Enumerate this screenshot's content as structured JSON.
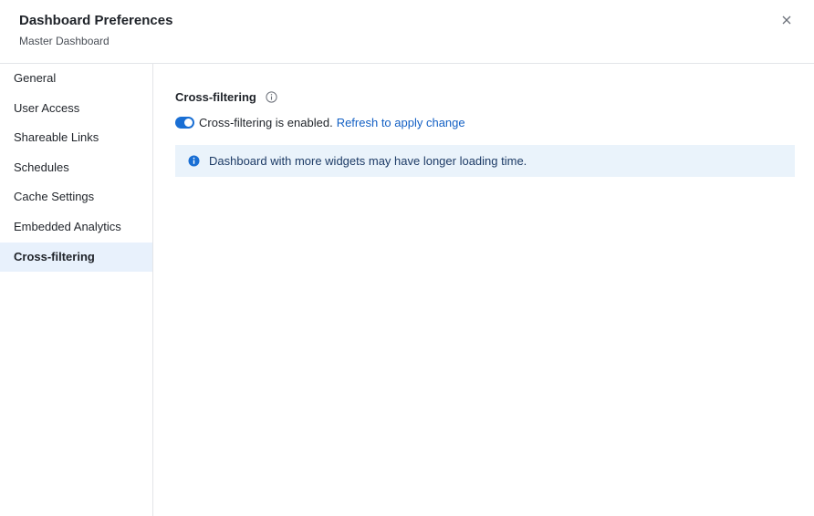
{
  "dialog": {
    "title": "Dashboard Preferences",
    "subtitle": "Master Dashboard",
    "close_icon": "close-icon"
  },
  "sidebar": {
    "items": [
      {
        "label": "General",
        "active": false
      },
      {
        "label": "User Access",
        "active": false
      },
      {
        "label": "Shareable Links",
        "active": false
      },
      {
        "label": "Schedules",
        "active": false
      },
      {
        "label": "Cache Settings",
        "active": false
      },
      {
        "label": "Embedded Analytics",
        "active": false
      },
      {
        "label": "Cross-filtering",
        "active": true
      }
    ]
  },
  "main": {
    "section_title": "Cross-filtering",
    "section_info_icon": "info-outline-icon",
    "toggle": {
      "state": "on",
      "status_text": "Cross-filtering is enabled.",
      "link_text": "Refresh to apply change"
    },
    "banner": {
      "icon": "info-filled-icon",
      "text": "Dashboard with more widgets may have longer loading time."
    }
  },
  "colors": {
    "accent": "#1a6fd4",
    "link": "#1360c4",
    "active_nav_bg": "#e8f1fc",
    "banner_bg": "#eaf3fb"
  }
}
